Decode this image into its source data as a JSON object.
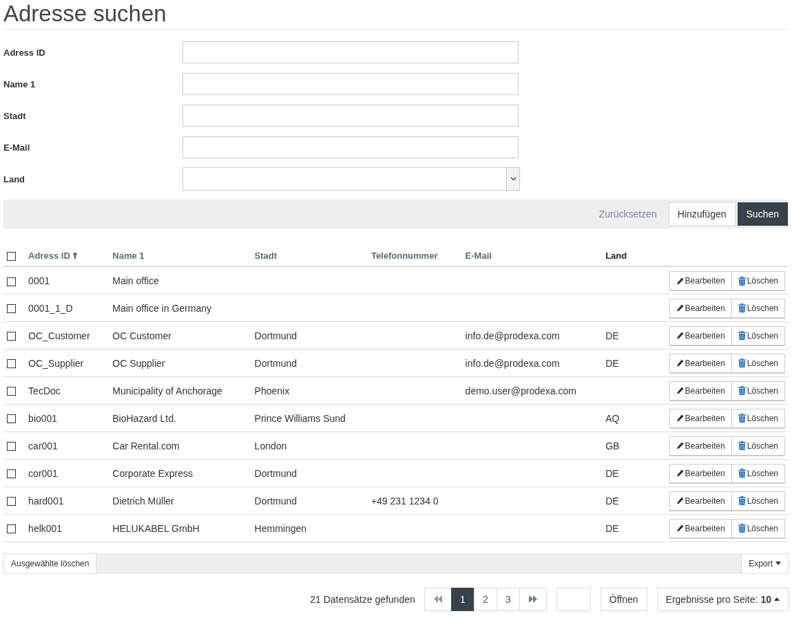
{
  "title": "Adresse suchen",
  "form": [
    {
      "label": "Adress ID",
      "kind": "text"
    },
    {
      "label": "Name 1",
      "kind": "text"
    },
    {
      "label": "Stadt",
      "kind": "text"
    },
    {
      "label": "E-Mail",
      "kind": "text"
    },
    {
      "label": "Land",
      "kind": "select"
    }
  ],
  "toolbar": {
    "reset": "Zurücksetzen",
    "add": "Hinzufügen",
    "search": "Suchen"
  },
  "table": {
    "select_all_checked": false,
    "columns": [
      {
        "label": "Adress ID",
        "sortable": true,
        "sorted": true
      },
      {
        "label": "Name 1",
        "sortable": true,
        "sorted": false
      },
      {
        "label": "Stadt",
        "sortable": true,
        "sorted": false
      },
      {
        "label": "Telefonnummer",
        "sortable": true,
        "sorted": false
      },
      {
        "label": "E-Mail",
        "sortable": true,
        "sorted": false
      },
      {
        "label": "Land",
        "sortable": false,
        "sorted": false
      }
    ],
    "rows": [
      {
        "checked": false,
        "cells": [
          "0001",
          "Main office",
          "",
          "",
          "",
          ""
        ],
        "edit": "Bearbeiten",
        "delete": "Löschen"
      },
      {
        "checked": false,
        "cells": [
          "0001_1_D",
          "Main office in Germany",
          "",
          "",
          "",
          ""
        ],
        "edit": "Bearbeiten",
        "delete": "Löschen"
      },
      {
        "checked": false,
        "cells": [
          "OC_Customer",
          "OC Customer",
          "Dortmund",
          "",
          "info.de@prodexa.com",
          "DE"
        ],
        "edit": "Bearbeiten",
        "delete": "Löschen"
      },
      {
        "checked": false,
        "cells": [
          "OC_Supplier",
          "OC Supplier",
          "Dortmund",
          "",
          "info.de@prodexa.com",
          "DE"
        ],
        "edit": "Bearbeiten",
        "delete": "Löschen"
      },
      {
        "checked": false,
        "cells": [
          "TecDoc",
          "Municipality of Anchorage",
          "Phoenix",
          "",
          "demo.user@prodexa.com",
          ""
        ],
        "edit": "Bearbeiten",
        "delete": "Löschen"
      },
      {
        "checked": false,
        "cells": [
          "bio001",
          "BioHazard Ltd.",
          "Prince Williams Sund",
          "",
          "",
          "AQ"
        ],
        "edit": "Bearbeiten",
        "delete": "Löschen"
      },
      {
        "checked": false,
        "cells": [
          "car001",
          "Car Rental.com",
          "London",
          "",
          "",
          "GB"
        ],
        "edit": "Bearbeiten",
        "delete": "Löschen"
      },
      {
        "checked": false,
        "cells": [
          "cor001",
          "Corporate Express",
          "Dortmund",
          "",
          "",
          "DE"
        ],
        "edit": "Bearbeiten",
        "delete": "Löschen"
      },
      {
        "checked": false,
        "cells": [
          "hard001",
          "Dietrich Müller",
          "Dortmund",
          "+49 231 1234 0",
          "",
          "DE"
        ],
        "edit": "Bearbeiten",
        "delete": "Löschen"
      },
      {
        "checked": false,
        "cells": [
          "helk001",
          "HELUKABEL GmbH",
          "Hemmingen",
          "",
          "",
          "DE"
        ],
        "edit": "Bearbeiten",
        "delete": "Löschen"
      }
    ]
  },
  "footer": {
    "delete_selected": "Ausgewählte löschen",
    "export": "Export"
  },
  "pagination": {
    "count": "21 Datensätze gefunden",
    "pages": [
      {
        "label": "1",
        "selected": true
      },
      {
        "label": "2",
        "selected": false
      },
      {
        "label": "3",
        "selected": false
      }
    ],
    "open": "Öffnen",
    "per_page": "Ergebnisse pro Seite: **10**"
  }
}
